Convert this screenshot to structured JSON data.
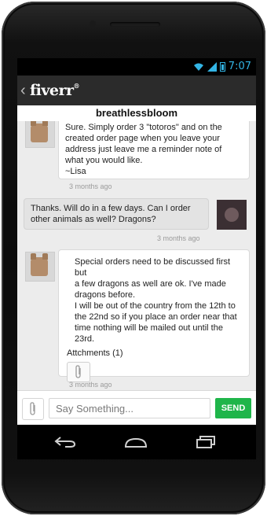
{
  "status": {
    "time": "7:07"
  },
  "app": {
    "logo": "fiverr",
    "logo_mark": "®"
  },
  "conversation": {
    "username": "breathlessbloom"
  },
  "messages": [
    {
      "sender": "seller",
      "lines": [
        "Sure. Simply order 3 \"totoros\" and on the",
        "created order page when you leave your",
        "address just leave me a reminder note of",
        "what you would like.",
        "~Lisa"
      ],
      "time": "3 months ago"
    },
    {
      "sender": "me",
      "lines": [
        "Thanks. Will do in a few days. Can I order",
        "other animals as well? Dragons?"
      ],
      "time": "3 months ago"
    },
    {
      "sender": "seller",
      "lines": [
        "Special orders need to be discussed first but",
        "a few dragons as well are ok. I've made",
        "dragons before.",
        "I will be out of the country from the 12th to",
        "the 22nd so if you place an order near that",
        "time nothing will be mailed out until the",
        "23rd."
      ],
      "attachments_label": "Attchments (1)",
      "time": "3 months ago"
    }
  ],
  "composer": {
    "placeholder": "Say Something...",
    "send_label": "SEND"
  },
  "icons": {
    "back": "chevron-left-icon",
    "attach": "paperclip-icon",
    "wifi": "wifi-icon",
    "signal": "signal-icon",
    "battery": "battery-icon",
    "nav_back": "nav-back-icon",
    "nav_home": "nav-home-icon",
    "nav_recents": "nav-recents-icon"
  },
  "colors": {
    "send": "#1fb54a",
    "appbar": "#2b2b2b",
    "status": "#33b5e5"
  }
}
